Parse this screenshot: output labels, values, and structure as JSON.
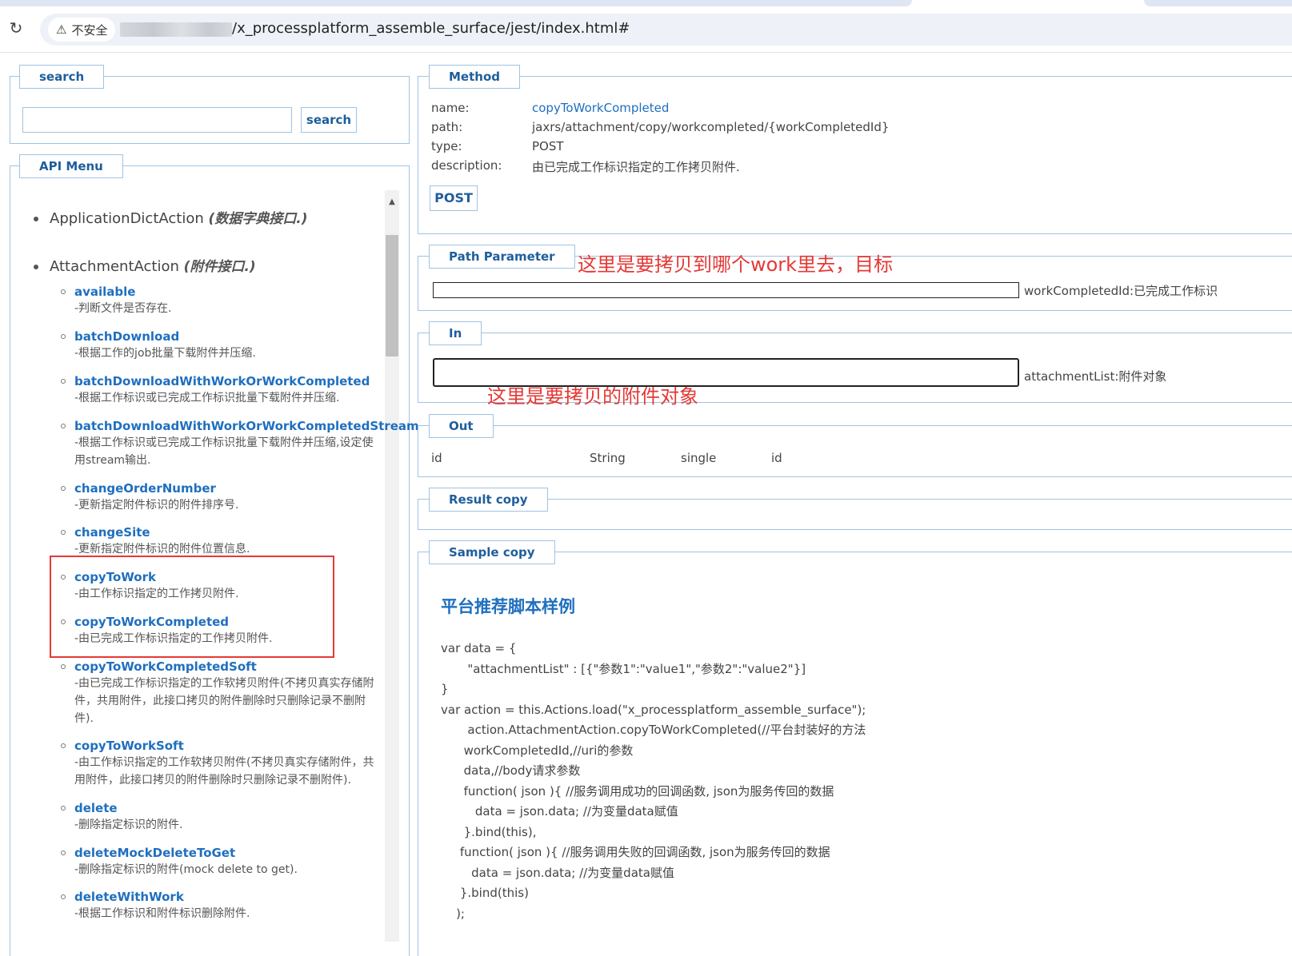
{
  "browser": {
    "security_label": "不安全",
    "url_path": "/x_processplatform_assemble_surface/jest/index.html#"
  },
  "search_panel": {
    "legend": "search",
    "input_value": "",
    "button_label": "search"
  },
  "api_menu": {
    "legend": "API Menu",
    "groups": [
      {
        "name": "ApplicationDictAction",
        "desc": "(数据字典接口.)"
      },
      {
        "name": "AttachmentAction",
        "desc": "(附件接口.)"
      }
    ],
    "items": [
      {
        "name": "available",
        "desc": "-判断文件是否存在."
      },
      {
        "name": "batchDownload",
        "desc": "-根据工作的job批量下载附件并压缩."
      },
      {
        "name": "batchDownloadWithWorkOrWorkCompleted",
        "desc": "-根据工作标识或已完成工作标识批量下载附件并压缩."
      },
      {
        "name": "batchDownloadWithWorkOrWorkCompletedStream",
        "desc": "-根据工作标识或已完成工作标识批量下载附件并压缩,设定使用stream输出."
      },
      {
        "name": "changeOrderNumber",
        "desc": "-更新指定附件标识的附件排序号."
      },
      {
        "name": "changeSite",
        "desc": "-更新指定附件标识的附件位置信息."
      },
      {
        "name": "copyToWork",
        "desc": "-由工作标识指定的工作拷贝附件."
      },
      {
        "name": "copyToWorkCompleted",
        "desc": "-由已完成工作标识指定的工作拷贝附件."
      },
      {
        "name": "copyToWorkCompletedSoft",
        "desc": "-由已完成工作标识指定的工作软拷贝附件(不拷贝真实存储附件，共用附件，此接口拷贝的附件删除时只删除记录不删附件)."
      },
      {
        "name": "copyToWorkSoft",
        "desc": "-由工作标识指定的工作软拷贝附件(不拷贝真实存储附件，共用附件，此接口拷贝的附件删除时只删除记录不删附件)."
      },
      {
        "name": "delete",
        "desc": "-删除指定标识的附件."
      },
      {
        "name": "deleteMockDeleteToGet",
        "desc": "-删除指定标识的附件(mock delete to get)."
      },
      {
        "name": "deleteWithWork",
        "desc": "-根据工作标识和附件标识删除附件."
      }
    ]
  },
  "method": {
    "legend": "Method",
    "labels": {
      "name": "name:",
      "path": "path:",
      "type": "type:",
      "description": "description:"
    },
    "name": "copyToWorkCompleted",
    "path": "jaxrs/attachment/copy/workcompleted/{workCompletedId}",
    "type": "POST",
    "description": "由已完成工作标识指定的工作拷贝附件.",
    "button_label": "POST"
  },
  "path_parameter": {
    "legend": "Path Parameter",
    "annotation": "这里是要拷贝到哪个work里去，目标",
    "input_value": "",
    "label": "workCompletedId:已完成工作标识"
  },
  "in": {
    "legend": "In",
    "annotation": "这里是要拷贝的附件对象",
    "textarea_value": "",
    "label": "attachmentList:附件对象"
  },
  "out": {
    "legend": "Out",
    "row": [
      "id",
      "String",
      "single",
      "id"
    ]
  },
  "result": {
    "legend": "Result copy"
  },
  "sample": {
    "legend": "Sample copy",
    "heading": "平台推荐脚本样例",
    "code": "var data = {\n       \"attachmentList\" : [{\"参数1\":\"value1\",\"参数2\":\"value2\"}]\n}\nvar action = this.Actions.load(\"x_processplatform_assemble_surface\");\n       action.AttachmentAction.copyToWorkCompleted(//平台封装好的方法\n      workCompletedId,//uri的参数\n      data,//body请求参数\n      function( json ){ //服务调用成功的回调函数, json为服务传回的数据\n         data = json.data; //为变量data赋值\n      }.bind(this),\n     function( json ){ //服务调用失败的回调函数, json为服务传回的数据\n        data = json.data; //为变量data赋值\n     }.bind(this)\n    );"
  }
}
